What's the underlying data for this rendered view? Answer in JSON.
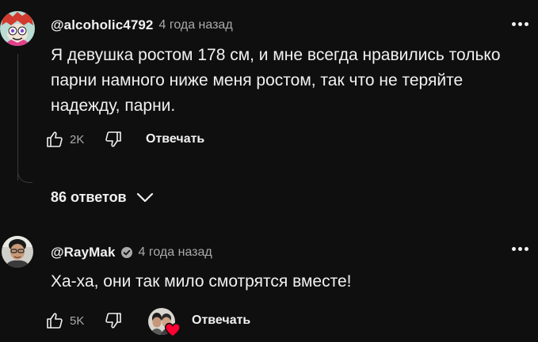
{
  "comments": [
    {
      "handle": "@alcoholic4792",
      "time": "4 года назад",
      "text_lines": [
        "Я девушка ростом 178 см, и мне всегда нравились только",
        "парни намного ниже меня ростом, так что не теряйте",
        "надежду, парни."
      ],
      "likes": "2K",
      "reply_label": "Отвечать",
      "replies_toggle": "86 ответов",
      "avatar_icon": "cartoon-avatar-icon"
    },
    {
      "handle": "@RayMak",
      "verified": true,
      "time": "4 года назад",
      "text": "Ха-ха, они так мило смотрятся вместе!",
      "likes": "5K",
      "reply_label": "Отвечать",
      "creator_heart": true,
      "avatar_icon": "photo-avatar-icon"
    }
  ],
  "colors": {
    "background": "#0f0f0f",
    "primary_text": "#f1f1f1",
    "secondary_text": "#aaaaaa",
    "heart": "#ff0033"
  }
}
